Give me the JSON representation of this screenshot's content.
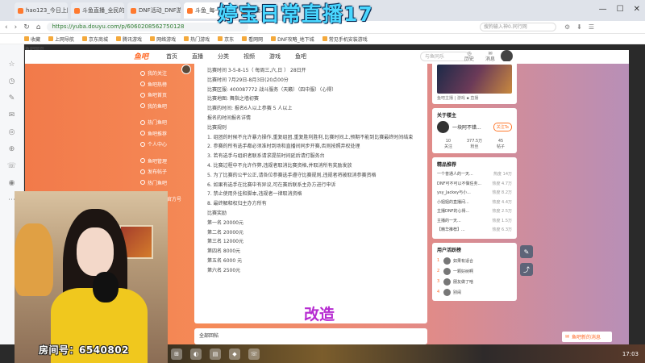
{
  "overlay": {
    "title": "婷宝日常直播17",
    "caption": "改造",
    "room_label": "房间号：6540802"
  },
  "browser": {
    "tabs": [
      {
        "label": "hao123_今日上网平台",
        "active": false
      },
      {
        "label": "斗鱼直播_全民的直播_最...",
        "active": false
      },
      {
        "label": "DNF活动_DNF游戏...",
        "active": false
      },
      {
        "label": "斗鱼_每一个...",
        "active": true
      },
      {
        "label": "直播...",
        "active": false
      }
    ],
    "url": "https://yuba.douyu.com/p/6060208562750128",
    "search_placeholder": "搜狗输入神0.同行网",
    "bookmarks": [
      "收藏",
      "上网导航",
      "京东商城",
      "腾讯游戏",
      "网络游戏",
      "热门游戏",
      "京东",
      "看网网",
      "DNF攻略_地下城",
      "常见手机安装游戏"
    ]
  },
  "site": {
    "name": "鱼吧网页",
    "logo": "鱼吧",
    "nav": [
      "首页",
      "直播",
      "分类",
      "视频",
      "游戏",
      "鱼吧"
    ],
    "search_placeholder": "与鱼同乐",
    "header_icons": [
      "历史",
      "消息"
    ],
    "sidebar": [
      "我的关注",
      "鱼吧热榜",
      "鱼吧首页",
      "我的鱼吧",
      "热门鱼吧",
      "鱼吧推荐",
      "个人中心",
      "鱼吧管理",
      "发布帖子",
      "热门鱼吧"
    ],
    "sidebar_footer": "关注鱼吧官方号"
  },
  "article": {
    "lines": [
      "比赛时间 3-5-8-15（ 每周三,六,日 ） 28日开",
      "比赛时间 7月29日-8月3日(20点00分",
      "比赛区服: 400087772 战斗服务（天籁）（四中服）（心得）",
      "比赛地图: 舞指之墙初赛",
      "比赛的时间: 报名6人以上参赛 5 人以上",
      "报名的时间报名详情",
      "比赛规则",
      "1. 组团的时候不允许暴力操作,重复组团,重复胜利胜利,比赛时间上,预期不能到比赛最终时间结束",
      "2. 参赛的所有选手都必须准时到场和直播间同步开赛,否则按照弃权处理",
      "3. 若有选手与组织者联系请求提前时间延后请打服务台",
      "4. 比赛过程中不允许作弊,违规者取消比赛资格,并取消所有奖励发放",
      "5. 为了比赛的公平公正,请各位参赛选手遵守比赛规则,违规者将被取消参赛资格",
      "6. 如果有选手在比赛中有异议,可在赛后联系主办方进行申诉",
      "7. 禁止使用外挂和脚本,违规者一律取消资格",
      "8. 最终解释权归主办方所有",
      "比赛奖励",
      "第一名 20000元",
      "第二名 20000元",
      "第三名 12000元",
      "第四名 8000元",
      "第五名 6000 元",
      "第六名 2500元"
    ],
    "comment_section": "全部回帖"
  },
  "right": {
    "banner_caption": "鱼吧主播 | 游戏 ▪ 直播",
    "author_title": "关于楼主",
    "author_name": "一块阿不错...",
    "follow_label": "关注Ta",
    "stats": [
      {
        "value": "10",
        "label": "关注"
      },
      {
        "value": "377.5万",
        "label": "粉丝"
      },
      {
        "value": "45",
        "label": "帖子"
      }
    ],
    "hot_title": "精品推荐",
    "hot": [
      {
        "text": "一个普通人的一天...",
        "meta": "热度 14万"
      },
      {
        "text": "DNF可不可以不做任务...",
        "meta": "热度 4.7万"
      },
      {
        "text": "ysy_Jackey与小...",
        "meta": "热度 8.2万"
      },
      {
        "text": "小姐姐的直播间...",
        "meta": "热度 4.4万"
      },
      {
        "text": "主播DNF的心得...",
        "meta": "热度 2.5万"
      },
      {
        "text": "主播的一天...",
        "meta": "热度 1.5万"
      },
      {
        "text": "【精华推荐】...",
        "meta": "热度 6.3万"
      }
    ],
    "rank_title": "用户活跃榜",
    "ranks": [
      {
        "n": "1",
        "name": "如果有适合"
      },
      {
        "n": "2",
        "name": "一颗好树啊"
      },
      {
        "n": "3",
        "name": "朋友做了啥"
      },
      {
        "n": "4",
        "name": "别闹"
      }
    ],
    "notify": "鱼吧新的消息"
  },
  "taskbar": {
    "clock": "17:03"
  }
}
